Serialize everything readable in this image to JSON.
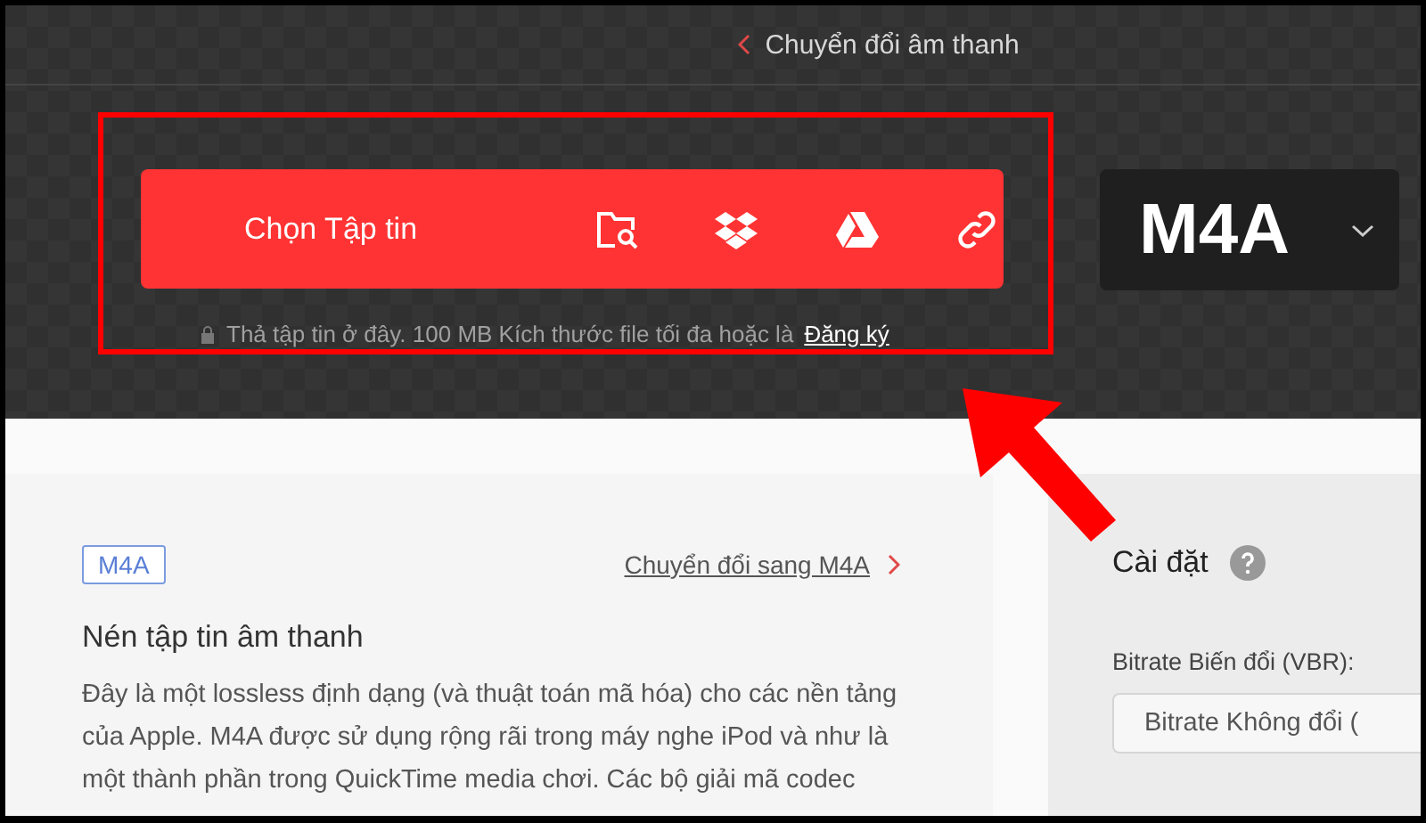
{
  "header": {
    "breadcrumb": "Chuyển đổi âm thanh"
  },
  "uploader": {
    "button_label": "Chọn Tập tin",
    "sources": [
      {
        "kind": "folder"
      },
      {
        "kind": "dropbox"
      },
      {
        "kind": "drive"
      },
      {
        "kind": "link"
      }
    ],
    "hint": "Thả tập tin ở đây. 100 MB Kích thước file tối đa hoặc là",
    "signup_link": "Đăng ký"
  },
  "format_picker": {
    "value": "M4A"
  },
  "info_panel": {
    "tag": "M4A",
    "convert_link": "Chuyển đổi sang M4A",
    "heading": "Nén tập tin âm thanh",
    "paragraph": "Đây là một lossless định dạng (và thuật toán mã hóa) cho các nền tảng của Apple. M4A được sử dụng rộng rãi trong máy nghe iPod và như là một thành phần trong QuickTime media chơi. Các bộ giải mã codec"
  },
  "settings_panel": {
    "title": "Cài đặt",
    "bitrate_label": "Bitrate Biến đổi (VBR):",
    "bitrate_value": "Bitrate Không đổi ("
  }
}
